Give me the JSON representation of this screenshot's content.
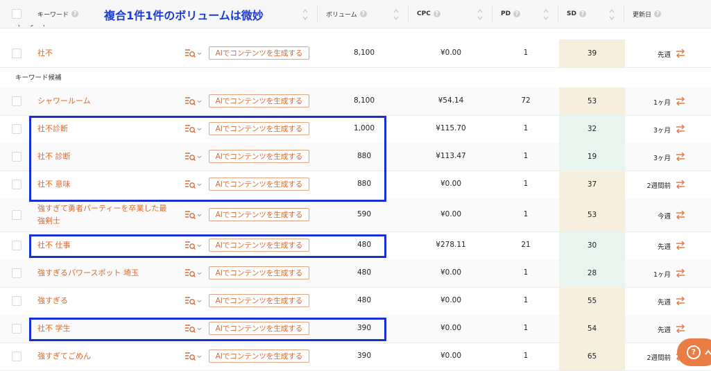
{
  "header": {
    "keyword_label": "キーワード",
    "annotation": "複合1件1件のボリュームは微妙",
    "volume_label": "ボリューム",
    "cpc_label": "CPC",
    "pd_label": "PD",
    "sd_label": "SD",
    "updated_label": "更新日",
    "help_glyph": "?"
  },
  "sections": {
    "keyword": "キーワード",
    "candidates": "キーワード候補"
  },
  "ai_button_label": "AIでコンテンツを生成する",
  "rows": [
    {
      "keyword": "社不",
      "volume": "8,100",
      "cpc": "¥0.00",
      "pd": "1",
      "sd": "39",
      "sd_color": "#f7efdd",
      "updated": "先週"
    },
    {
      "keyword": "シャワールーム",
      "volume": "8,100",
      "cpc": "¥54.14",
      "pd": "72",
      "sd": "53",
      "sd_color": "#f7efdd",
      "updated": "1ヶ月"
    },
    {
      "keyword": "社不診断",
      "volume": "1,000",
      "cpc": "¥115.70",
      "pd": "1",
      "sd": "32",
      "sd_color": "#e8f5ee",
      "updated": "3ヶ月"
    },
    {
      "keyword": "社不 診断",
      "volume": "880",
      "cpc": "¥113.47",
      "pd": "1",
      "sd": "19",
      "sd_color": "#e8f5ee",
      "updated": "3ヶ月"
    },
    {
      "keyword": "社不 意味",
      "volume": "880",
      "cpc": "¥0.00",
      "pd": "1",
      "sd": "37",
      "sd_color": "#f7efdd",
      "updated": "2週間前"
    },
    {
      "keyword_line1": "強すぎて勇者パーティーを卒業した最",
      "keyword_line2": "強剣士",
      "volume": "590",
      "cpc": "¥0.00",
      "pd": "1",
      "sd": "53",
      "sd_color": "#f7efdd",
      "updated": "今週"
    },
    {
      "keyword": "社不 仕事",
      "volume": "480",
      "cpc": "¥278.11",
      "pd": "21",
      "sd": "30",
      "sd_color": "#e8f5ee",
      "updated": "先週"
    },
    {
      "keyword": "強すぎるパワースポット 埼玉",
      "volume": "480",
      "cpc": "¥0.00",
      "pd": "1",
      "sd": "28",
      "sd_color": "#e8f5ee",
      "updated": "1ヶ月"
    },
    {
      "keyword": "強すぎる",
      "volume": "480",
      "cpc": "¥0.00",
      "pd": "1",
      "sd": "55",
      "sd_color": "#f7efdd",
      "updated": "先週"
    },
    {
      "keyword": "社不 学生",
      "volume": "390",
      "cpc": "¥0.00",
      "pd": "1",
      "sd": "54",
      "sd_color": "#f7efdd",
      "updated": "先週"
    },
    {
      "keyword": "強すぎてごめん",
      "volume": "390",
      "cpc": "¥0.00",
      "pd": "1",
      "sd": "65",
      "sd_color": "#f7efdd",
      "updated": "2週間前"
    }
  ],
  "colors": {
    "keyword_text": "#d9692e",
    "highlight_box": "#1a2fd1",
    "help_button": "#ea7d45"
  },
  "icons": {
    "refresh": "refresh-icon",
    "tools": "keyword-tools-icon",
    "sort": "sort-icon",
    "help": "help-icon"
  }
}
